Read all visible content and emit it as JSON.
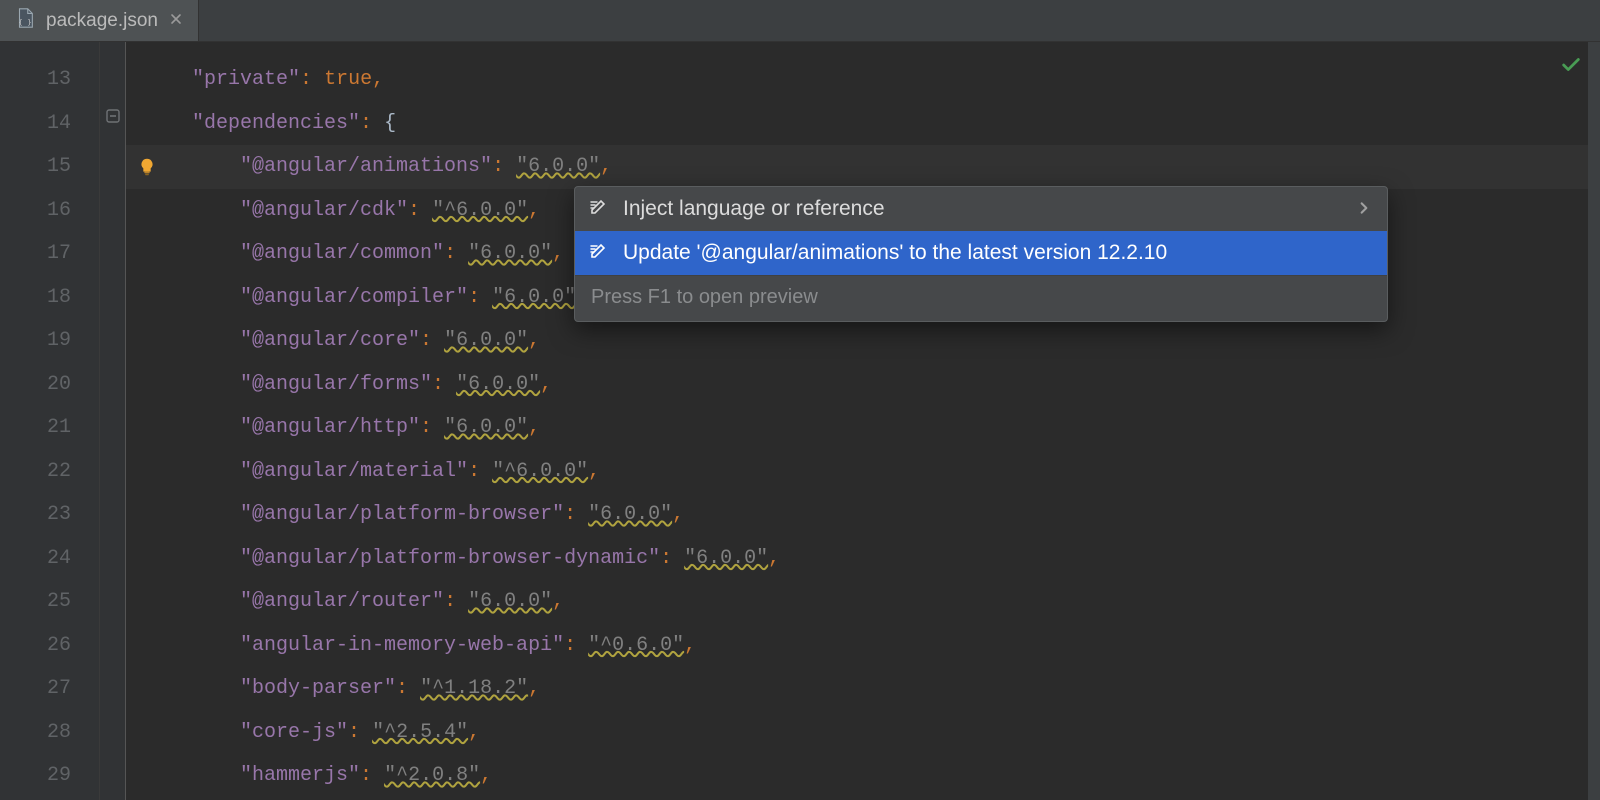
{
  "tab": {
    "filename": "package.json"
  },
  "gutter": {
    "start": 13,
    "end": 29
  },
  "code": {
    "indent1": "    ",
    "indent2": "        ",
    "lines": [
      {
        "ln": 13,
        "type": "kv_kw",
        "key": "\"private\"",
        "value": "true",
        "trail": ","
      },
      {
        "ln": 14,
        "type": "kv_brace",
        "key": "\"dependencies\"",
        "value": "{",
        "trail": ""
      },
      {
        "ln": 15,
        "type": "dep",
        "key": "\"@angular/animations\"",
        "value": "\"6.0.0\"",
        "trail": ",",
        "warn": true,
        "current": true
      },
      {
        "ln": 16,
        "type": "dep",
        "key": "\"@angular/cdk\"",
        "value": "\"^6.0.0\"",
        "trail": ",",
        "warn": true
      },
      {
        "ln": 17,
        "type": "dep",
        "key": "\"@angular/common\"",
        "value": "\"6.0.0\"",
        "trail": ",",
        "warn": true
      },
      {
        "ln": 18,
        "type": "dep",
        "key": "\"@angular/compiler\"",
        "value": "\"6.0.0\"",
        "trail": ",",
        "warn": true
      },
      {
        "ln": 19,
        "type": "dep",
        "key": "\"@angular/core\"",
        "value": "\"6.0.0\"",
        "trail": ",",
        "warn": true
      },
      {
        "ln": 20,
        "type": "dep",
        "key": "\"@angular/forms\"",
        "value": "\"6.0.0\"",
        "trail": ",",
        "warn": true
      },
      {
        "ln": 21,
        "type": "dep",
        "key": "\"@angular/http\"",
        "value": "\"6.0.0\"",
        "trail": ",",
        "warn": true
      },
      {
        "ln": 22,
        "type": "dep",
        "key": "\"@angular/material\"",
        "value": "\"^6.0.0\"",
        "trail": ",",
        "warn": true
      },
      {
        "ln": 23,
        "type": "dep",
        "key": "\"@angular/platform-browser\"",
        "value": "\"6.0.0\"",
        "trail": ",",
        "warn": true
      },
      {
        "ln": 24,
        "type": "dep",
        "key": "\"@angular/platform-browser-dynamic\"",
        "value": "\"6.0.0\"",
        "trail": ",",
        "warn": true
      },
      {
        "ln": 25,
        "type": "dep",
        "key": "\"@angular/router\"",
        "value": "\"6.0.0\"",
        "trail": ",",
        "warn": true
      },
      {
        "ln": 26,
        "type": "dep",
        "key": "\"angular-in-memory-web-api\"",
        "value": "\"^0.6.0\"",
        "trail": ",",
        "warn": true
      },
      {
        "ln": 27,
        "type": "dep",
        "key": "\"body-parser\"",
        "value": "\"^1.18.2\"",
        "trail": ",",
        "warn": true
      },
      {
        "ln": 28,
        "type": "dep",
        "key": "\"core-js\"",
        "value": "\"^2.5.4\"",
        "trail": ",",
        "warn": true
      },
      {
        "ln": 29,
        "type": "dep",
        "key": "\"hammerjs\"",
        "value": "\"^2.0.8\"",
        "trail": ",",
        "warn": true
      }
    ]
  },
  "popup": {
    "items": [
      {
        "label": "Inject language or reference",
        "chevron": true,
        "selected": false
      },
      {
        "label": "Update '@angular/animations' to the latest version 12.2.10",
        "chevron": false,
        "selected": true
      }
    ],
    "footer": "Press F1 to open preview"
  }
}
